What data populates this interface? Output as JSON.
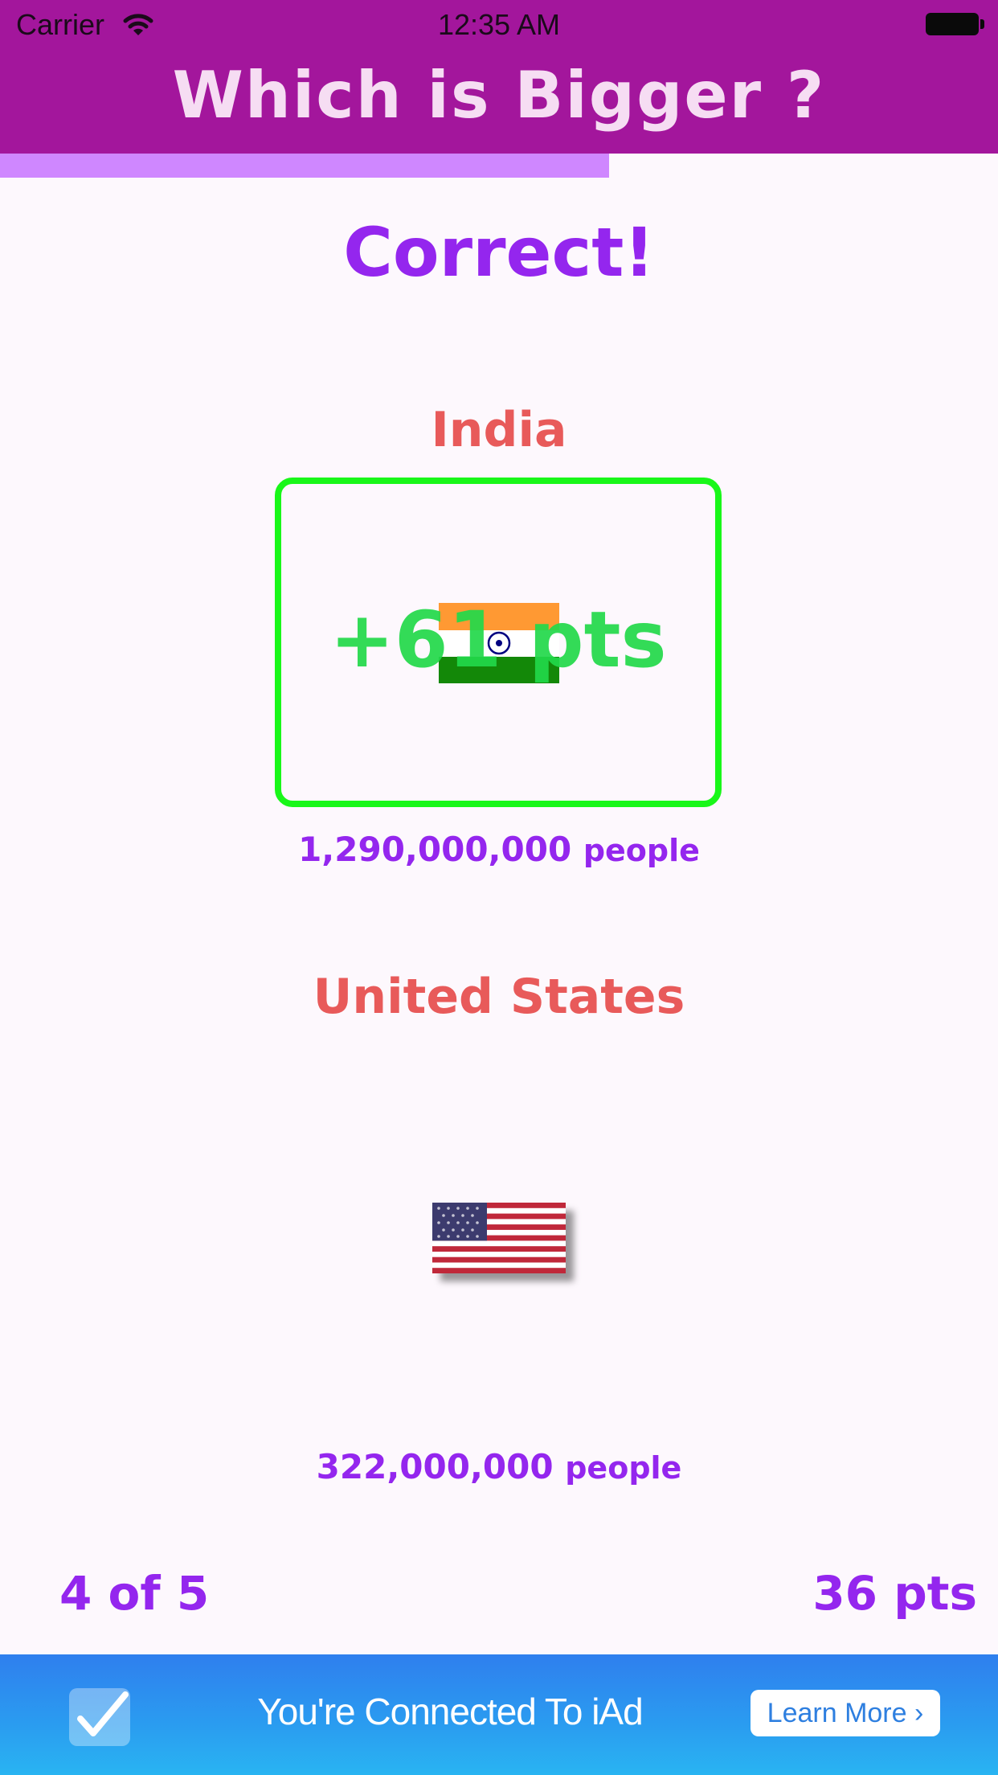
{
  "status_bar": {
    "carrier": "Carrier",
    "time": "12:35 AM"
  },
  "header": {
    "title": "Which is Bigger ?"
  },
  "progress": {
    "fraction": 0.61,
    "color": "#cf87ff"
  },
  "result": {
    "text": "Correct!"
  },
  "country1": {
    "name": "India",
    "flag_icon": "india-flag-icon",
    "points_gain": "+61 pts",
    "population_value": "1,290,000,000",
    "population_unit": "people",
    "highlight_color": "#19f719"
  },
  "country2": {
    "name": "United States",
    "flag_icon": "usa-flag-icon",
    "population_value": "322,000,000",
    "population_unit": "people"
  },
  "footer": {
    "counter": "4 of 5",
    "score": "36 pts"
  },
  "ad": {
    "message": "You're Connected To iAd",
    "button_label": "Learn More",
    "button_chevron": "›"
  },
  "colors": {
    "header_bg": "#a3169c",
    "accent_purple": "#9426ee",
    "country_name": "#e85a5a",
    "points_green": "#22d94a"
  }
}
